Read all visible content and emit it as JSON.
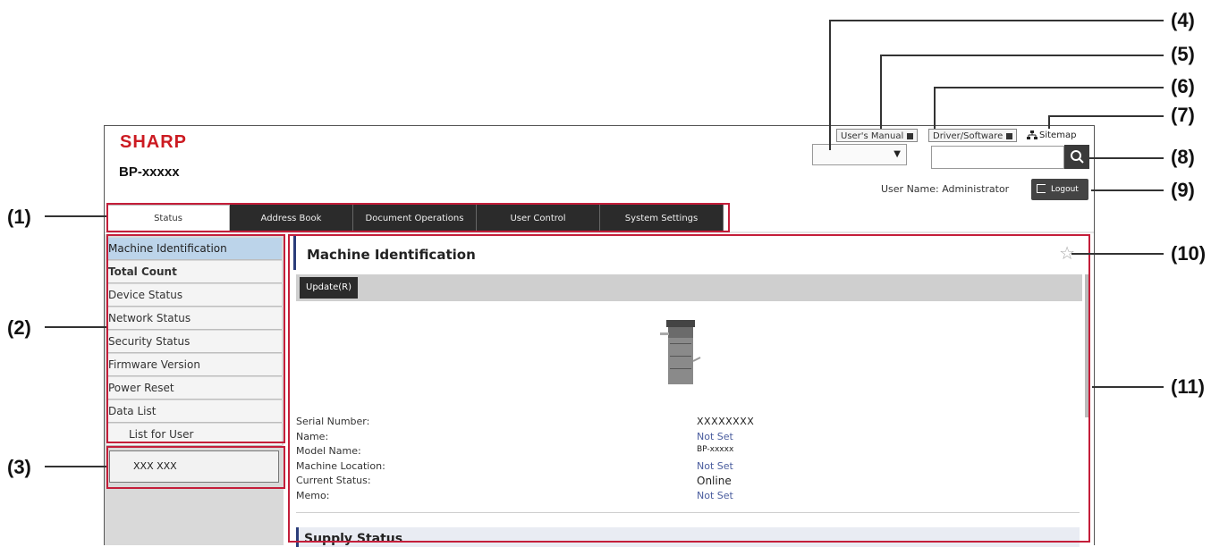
{
  "header": {
    "brand": "SHARP",
    "model": "BP-xxxxx",
    "links": {
      "users_manual": "User's Manual",
      "driver_software": "Driver/Software",
      "sitemap": "Sitemap"
    },
    "user_name": "User Name: Administrator",
    "logout_label": "Logout"
  },
  "tabs": [
    {
      "label": "Status"
    },
    {
      "label": "Address Book"
    },
    {
      "label": "Document Operations"
    },
    {
      "label": "User Control"
    },
    {
      "label": "System Settings"
    }
  ],
  "sidebar": {
    "items": [
      {
        "label": "Machine Identification"
      },
      {
        "label": "Total Count"
      },
      {
        "label": "Device Status"
      },
      {
        "label": "Network Status"
      },
      {
        "label": "Security Status"
      },
      {
        "label": "Firmware Version"
      },
      {
        "label": "Power Reset"
      },
      {
        "label": "Data List"
      },
      {
        "label": "List for User"
      }
    ],
    "user_box": "XXX XXX"
  },
  "main": {
    "title": "Machine Identification",
    "update_label": "Update(R)",
    "info": [
      {
        "label": "Serial Number:",
        "value": "XXXXXXXX"
      },
      {
        "label": "Name:",
        "value": "Not Set"
      },
      {
        "label": "Model Name:",
        "value": "BP-xxxxx"
      },
      {
        "label": "Machine Location:",
        "value": "Not Set"
      },
      {
        "label": "Current Status:",
        "value": "Online"
      },
      {
        "label": "Memo:",
        "value": "Not Set"
      }
    ],
    "supply_title": "Supply Status"
  },
  "callouts": [
    "(1)",
    "(2)",
    "(3)",
    "(4)",
    "(5)",
    "(6)",
    "(7)",
    "(8)",
    "(9)",
    "(10)",
    "(11)"
  ],
  "colors": {
    "brand_red": "#cc1b22",
    "callout_red": "#c41e3a",
    "tab_dark": "#2b2b2b",
    "active_side": "#bcd4ea",
    "accent_blue": "#2b3d7a"
  }
}
